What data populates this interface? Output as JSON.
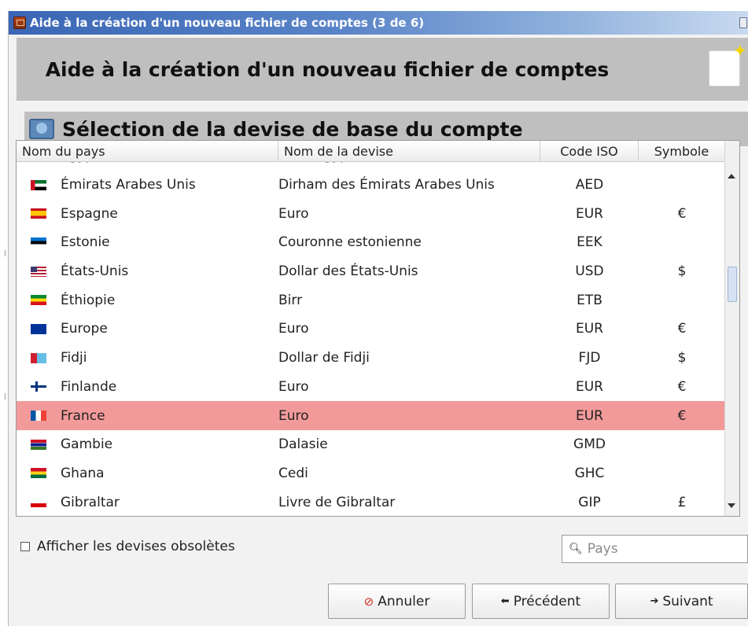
{
  "window": {
    "title": "Aide à la création d'un nouveau fichier de comptes (3 de 6)"
  },
  "banner": {
    "heading": "Aide à la création d'un nouveau fichier de comptes"
  },
  "section": {
    "title": "Sélection de la devise de base du compte"
  },
  "table": {
    "columns": {
      "country": "Nom du pays",
      "currency": "Nom de la devise",
      "iso": "Code ISO",
      "symbol": "Symbole"
    },
    "rows": [
      {
        "country": "Égypte",
        "currency": "Livre égyptienne",
        "iso": "EGP",
        "symbol": "£",
        "flag": "egypt"
      },
      {
        "country": "Émirats Arabes Unis",
        "currency": "Dirham des Émirats Arabes Unis",
        "iso": "AED",
        "symbol": "",
        "flag": "uae"
      },
      {
        "country": "Espagne",
        "currency": "Euro",
        "iso": "EUR",
        "symbol": "€",
        "flag": "spain"
      },
      {
        "country": "Estonie",
        "currency": "Couronne estonienne",
        "iso": "EEK",
        "symbol": "",
        "flag": "estonia"
      },
      {
        "country": "États-Unis",
        "currency": "Dollar des États-Unis",
        "iso": "USD",
        "symbol": "$",
        "flag": "usa"
      },
      {
        "country": "Éthiopie",
        "currency": "Birr",
        "iso": "ETB",
        "symbol": "",
        "flag": "ethiopia"
      },
      {
        "country": "Europe",
        "currency": "Euro",
        "iso": "EUR",
        "symbol": "€",
        "flag": "europe"
      },
      {
        "country": "Fidji",
        "currency": "Dollar de Fidji",
        "iso": "FJD",
        "symbol": "$",
        "flag": "fiji"
      },
      {
        "country": "Finlande",
        "currency": "Euro",
        "iso": "EUR",
        "symbol": "€",
        "flag": "finland"
      },
      {
        "country": "France",
        "currency": "Euro",
        "iso": "EUR",
        "symbol": "€",
        "flag": "france",
        "selected": true
      },
      {
        "country": "Gambie",
        "currency": "Dalasie",
        "iso": "GMD",
        "symbol": "",
        "flag": "gambia"
      },
      {
        "country": "Ghana",
        "currency": "Cedi",
        "iso": "GHC",
        "symbol": "",
        "flag": "ghana"
      },
      {
        "country": "Gibraltar",
        "currency": "Livre de Gibraltar",
        "iso": "GIP",
        "symbol": "£",
        "flag": "gibraltar"
      }
    ],
    "selected_color": "#f29a9a"
  },
  "options": {
    "show_obsolete_label": "Afficher les devises obsolètes",
    "show_obsolete_checked": false
  },
  "search": {
    "icon": "search-icon",
    "placeholder": "Pays",
    "value": ""
  },
  "buttons": {
    "cancel": "Annuler",
    "previous": "Précédent",
    "next": "Suivant"
  },
  "colors": {
    "titlebar_accent": "#3a66b5",
    "banner_bg": "#bfbfbf"
  }
}
